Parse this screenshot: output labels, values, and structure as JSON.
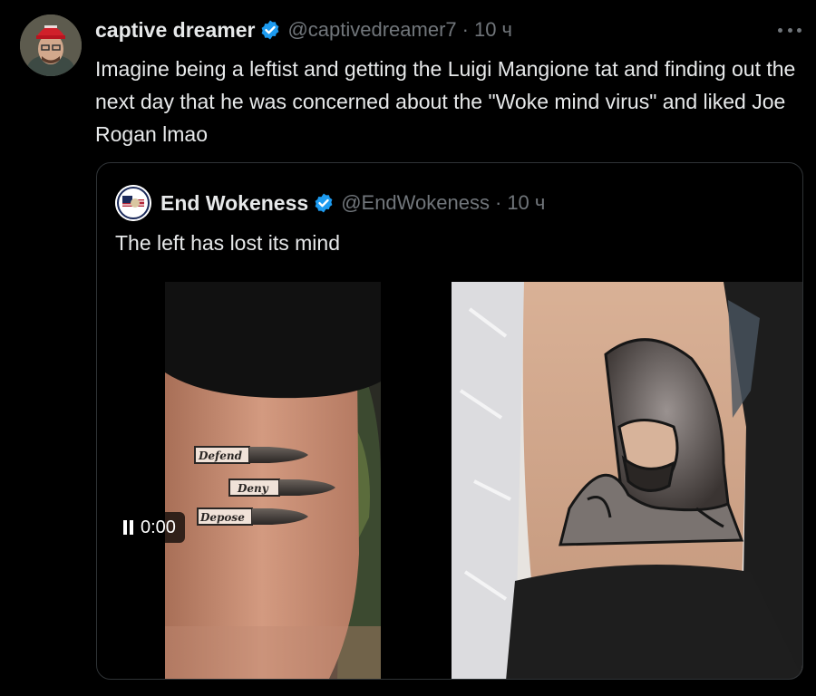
{
  "post": {
    "author_name": "captive dreamer",
    "author_handle": "@captivedreamer7",
    "separator": "·",
    "time": "10 ч",
    "text": "Imagine being a leftist and getting the Luigi Mangione tat and finding out the next day that he was concerned about the \"Woke mind virus\" and liked Joe Rogan lmao"
  },
  "quoted": {
    "author_name": "End Wokeness",
    "author_handle": "@EndWokeness",
    "separator": "·",
    "time": "10 ч",
    "text": "The left has lost its mind"
  },
  "media": {
    "video_time": "0:00",
    "tattoo_words": [
      "Defend",
      "Deny",
      "Depose"
    ]
  },
  "colors": {
    "background": "#000000",
    "text_primary": "#e7e9ea",
    "text_secondary": "#71767b",
    "border": "#2f3336",
    "verified_blue": "#1d9bf0"
  },
  "icons": {
    "verified": "verified-badge-icon",
    "more": "more-options-icon",
    "pause": "pause-icon"
  }
}
